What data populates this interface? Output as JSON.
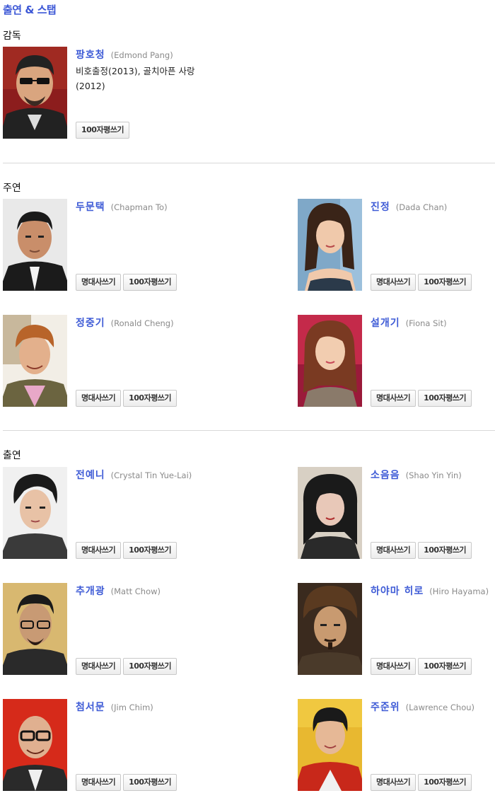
{
  "page_title": "출연 & 스탭",
  "sections": {
    "director": "감독",
    "lead": "주연",
    "cast": "출연"
  },
  "buttons": {
    "quote": "명대사쓰기",
    "review": "100자평쓰기"
  },
  "director": {
    "name": "팡호청",
    "ename": "(Edmond Pang)",
    "filmography": "비호출정(2013), 골치아픈 사랑(2012)"
  },
  "lead": [
    {
      "name": "두문택",
      "ename": "(Chapman To)"
    },
    {
      "name": "진정",
      "ename": "(Dada Chan)"
    },
    {
      "name": "정중기",
      "ename": "(Ronald Cheng)"
    },
    {
      "name": "설개기",
      "ename": "(Fiona Sit)"
    }
  ],
  "cast": [
    {
      "name": "전예니",
      "ename": "(Crystal Tin Yue-Lai)"
    },
    {
      "name": "소음음",
      "ename": "(Shao Yin Yin)"
    },
    {
      "name": "추개광",
      "ename": "(Matt Chow)"
    },
    {
      "name": "하야마 히로",
      "ename": "(Hiro Hayama)"
    },
    {
      "name": "첨서문",
      "ename": "(Jim Chim)"
    },
    {
      "name": "주준위",
      "ename": "(Lawrence Chou)"
    }
  ],
  "icons": {
    "portrait": "person-photo-icon"
  },
  "colors": {
    "title": "#3c57d6",
    "name_link": "#3e5bd6",
    "english_name": "#8a8a8a",
    "divider": "#d9d9d9"
  }
}
